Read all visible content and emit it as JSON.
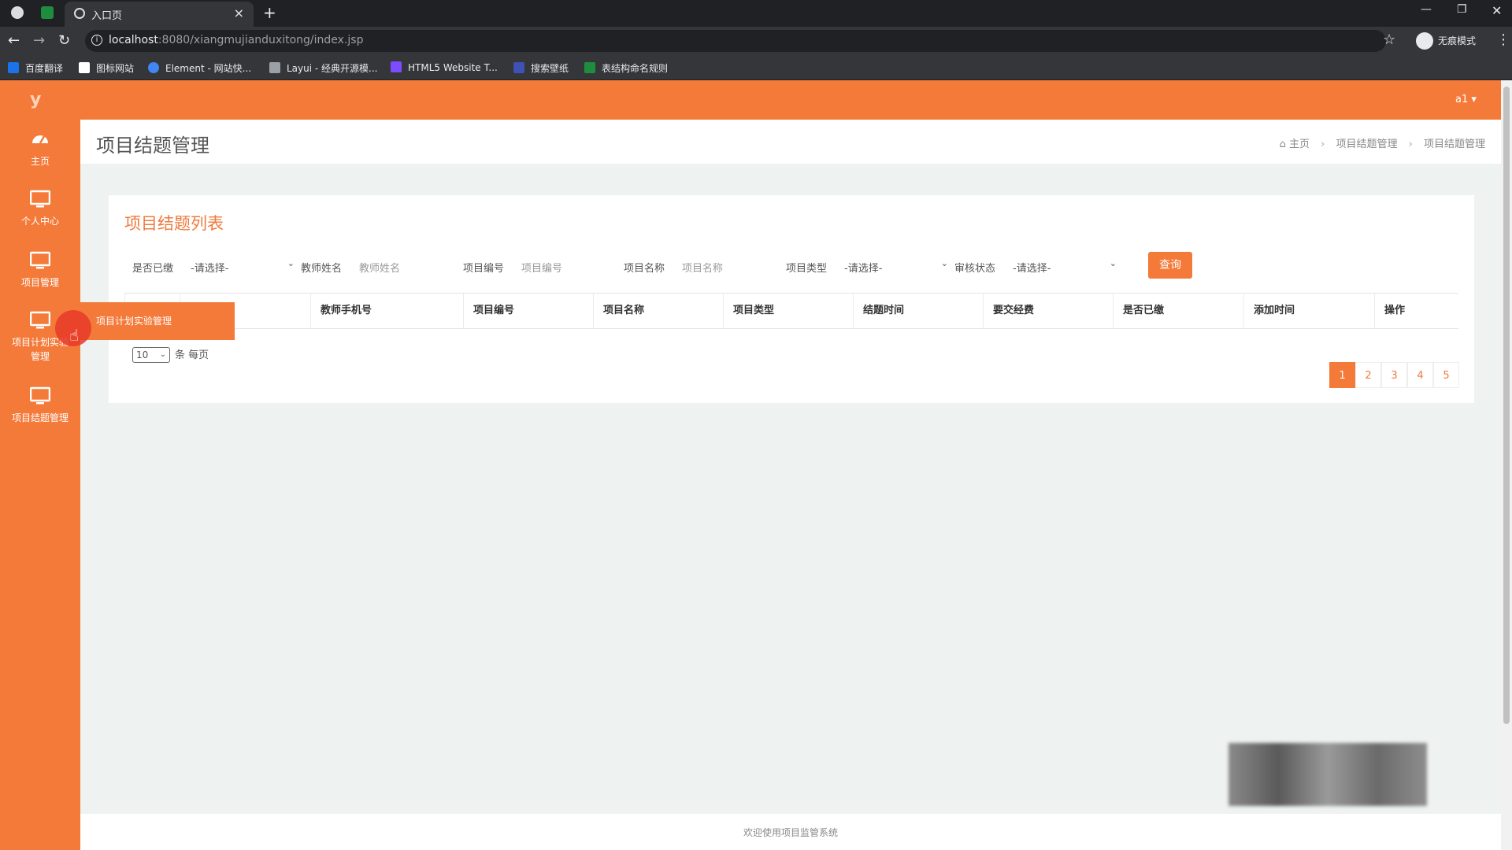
{
  "browser": {
    "tab_title": "入口页",
    "url_host": "localhost",
    "url_rest": ":8080/xiangmujianduxitong/index.jsp",
    "incognito_label": "无痕模式",
    "bookmarks": [
      {
        "label": "百度翻译",
        "color": "#1a73e8"
      },
      {
        "label": "图标网站",
        "color": "#ffffff"
      },
      {
        "label": "Element - 网站快...",
        "color": "#4285f4"
      },
      {
        "label": "Layui - 经典开源模...",
        "color": "#9aa0a6"
      },
      {
        "label": "HTML5 Website T...",
        "color": "#7c4dff"
      },
      {
        "label": "搜索壁纸",
        "color": "#3f51b5"
      },
      {
        "label": "表结构命名规则",
        "color": "#1e8e3e"
      }
    ]
  },
  "app": {
    "logo": "y",
    "user": "a1 ▾",
    "colors": {
      "accent": "#f47a3a",
      "title": "#ef7a3c"
    },
    "sidebar": {
      "items": [
        {
          "label": "主页",
          "icon": "dashboard-icon"
        },
        {
          "label": "个人中心",
          "icon": "monitor-icon"
        },
        {
          "label": "项目管理",
          "icon": "monitor-icon"
        },
        {
          "label1": "项目计划实验",
          "label2": "管理",
          "icon": "monitor-icon"
        },
        {
          "label": "项目结题管理",
          "icon": "monitor-icon"
        }
      ],
      "flyout": "项目计划实验管理"
    },
    "header": {
      "title": "项目结题管理",
      "breadcrumb": [
        "主页",
        "项目结题管理",
        "项目结题管理"
      ]
    },
    "panel": {
      "title": "项目结题列表",
      "filters": {
        "paid_label": "是否已缴",
        "paid_value": "-请选择-",
        "teacher_label": "教师姓名",
        "teacher_placeholder": "教师姓名",
        "code_label": "项目编号",
        "code_placeholder": "项目编号",
        "name_label": "项目名称",
        "name_placeholder": "项目名称",
        "type_label": "项目类型",
        "type_value": "-请选择-",
        "status_label": "审核状态",
        "status_value": "-请选择-",
        "query_button": "查询"
      },
      "columns": [
        "教师手机号",
        "项目编号",
        "项目名称",
        "项目类型",
        "结题时间",
        "要交经费",
        "是否已缴",
        "添加时间",
        "操作"
      ],
      "page_size": "10",
      "page_size_suffix": "条 每页",
      "pages": [
        "1",
        "2",
        "3",
        "4",
        "5"
      ],
      "active_page": "1"
    },
    "footer": "欢迎使用项目监管系统"
  }
}
